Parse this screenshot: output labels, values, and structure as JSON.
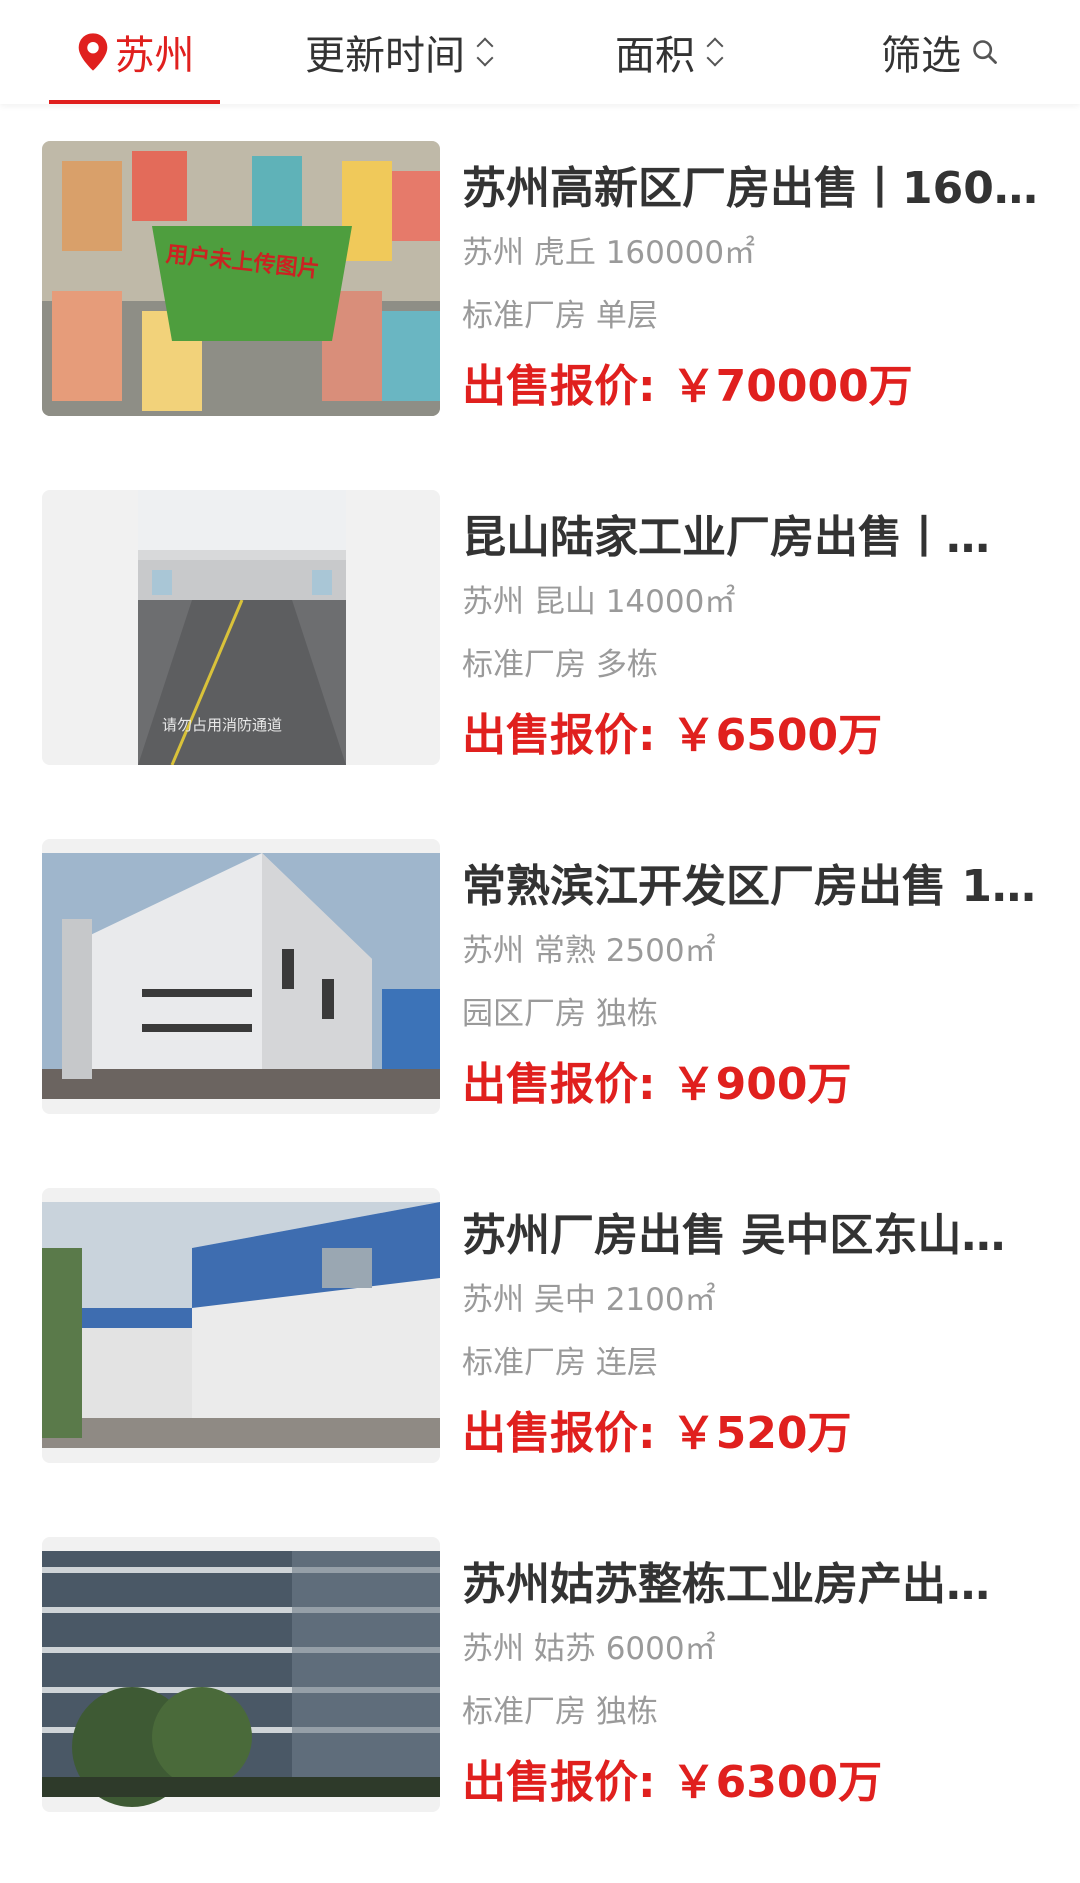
{
  "filter_bar": {
    "city": "苏州",
    "update_time": "更新时间",
    "area": "面积",
    "filter": "筛选",
    "accent_color": "#e0201e"
  },
  "listings": [
    {
      "title": "苏州高新区厂房出售丨160…",
      "location": "苏州 虎丘 160000㎡",
      "type": "标准厂房 单层",
      "price_label": "出售报价:",
      "price_value": "￥70000万",
      "image": "placeholder-illustration",
      "image_text": "用户未上传图片"
    },
    {
      "title": "昆山陆家工业厂房出售丨…",
      "location": "苏州 昆山 14000㎡",
      "type": "标准厂房 多栋",
      "price_label": "出售报价:",
      "price_value": "￥6500万",
      "image": "warehouse-interior-photo",
      "image_text": "请勿占用消防通道"
    },
    {
      "title": "常熟滨江开发区厂房出售 1…",
      "location": "苏州 常熟 2500㎡",
      "type": "园区厂房 独栋",
      "price_label": "出售报价:",
      "price_value": "￥900万",
      "image": "white-factory-building-photo"
    },
    {
      "title": "苏州厂房出售 吴中区东山…",
      "location": "苏州 吴中 2100㎡",
      "type": "标准厂房 连层",
      "price_label": "出售报价:",
      "price_value": "￥520万",
      "image": "blue-white-building-photo"
    },
    {
      "title": "苏州姑苏整栋工业房产出…",
      "location": "苏州 姑苏 6000㎡",
      "type": "标准厂房 独栋",
      "price_label": "出售报价:",
      "price_value": "￥6300万",
      "image": "glass-office-building-photo"
    }
  ]
}
